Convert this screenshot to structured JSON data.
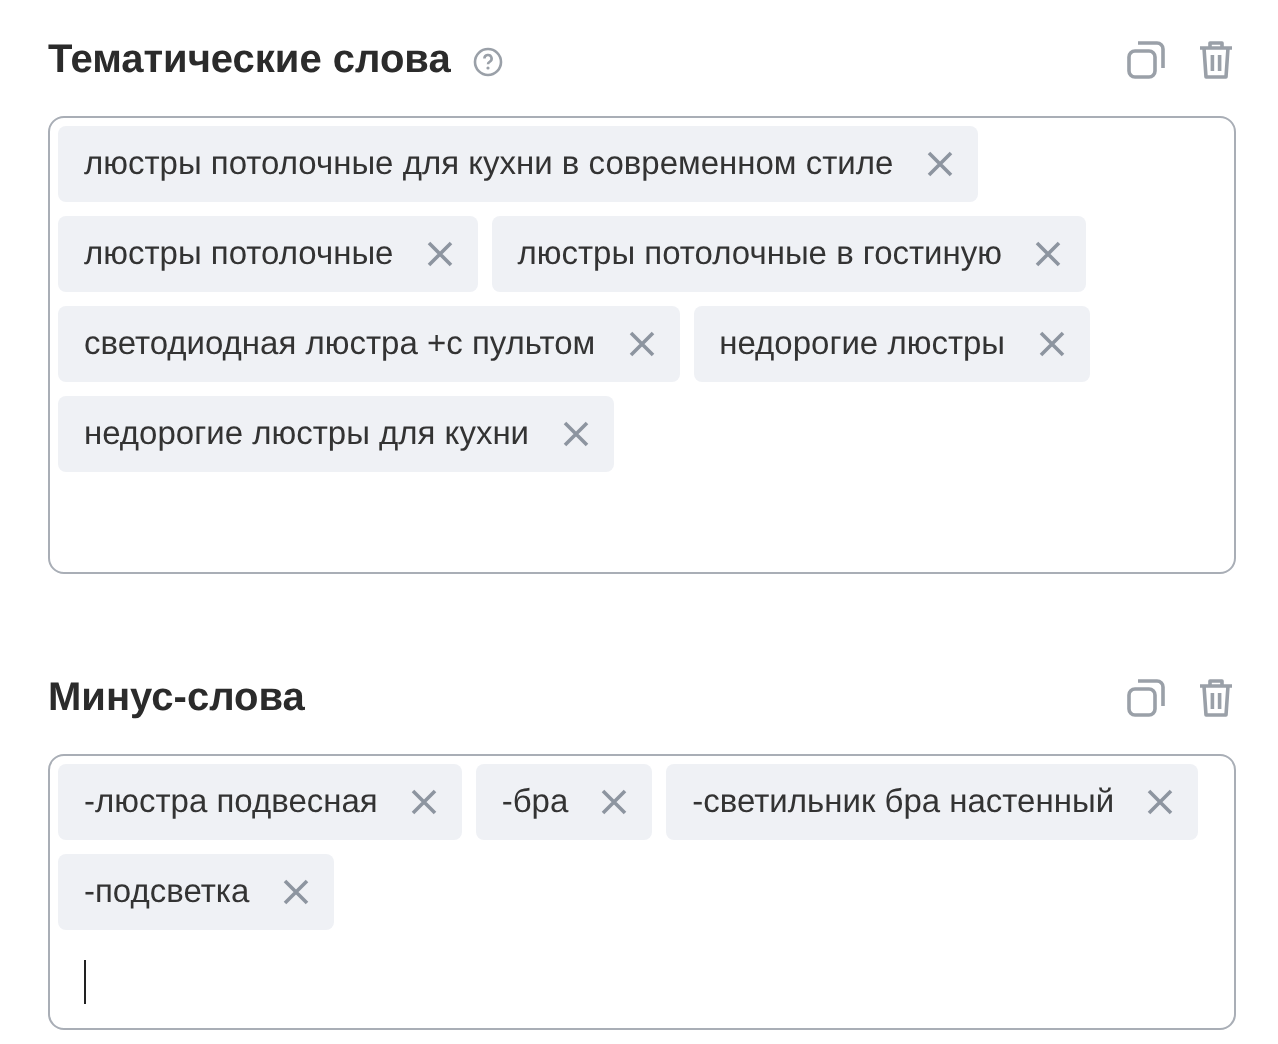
{
  "sections": [
    {
      "title": "Тематические слова",
      "help_icon": true,
      "focused": false,
      "tags": [
        "люстры потолочные для кухни в современном стиле",
        "люстры потолочные",
        "люстры потолочные в гостиную",
        "светодиодная люстра +с пультом",
        "недорогие люстры",
        "недорогие люстры для кухни"
      ]
    },
    {
      "title": "Минус-слова",
      "help_icon": false,
      "focused": true,
      "tags": [
        "-люстра подвесная",
        "-бра",
        "-светильник бра настенный",
        "-подсветка"
      ]
    }
  ]
}
